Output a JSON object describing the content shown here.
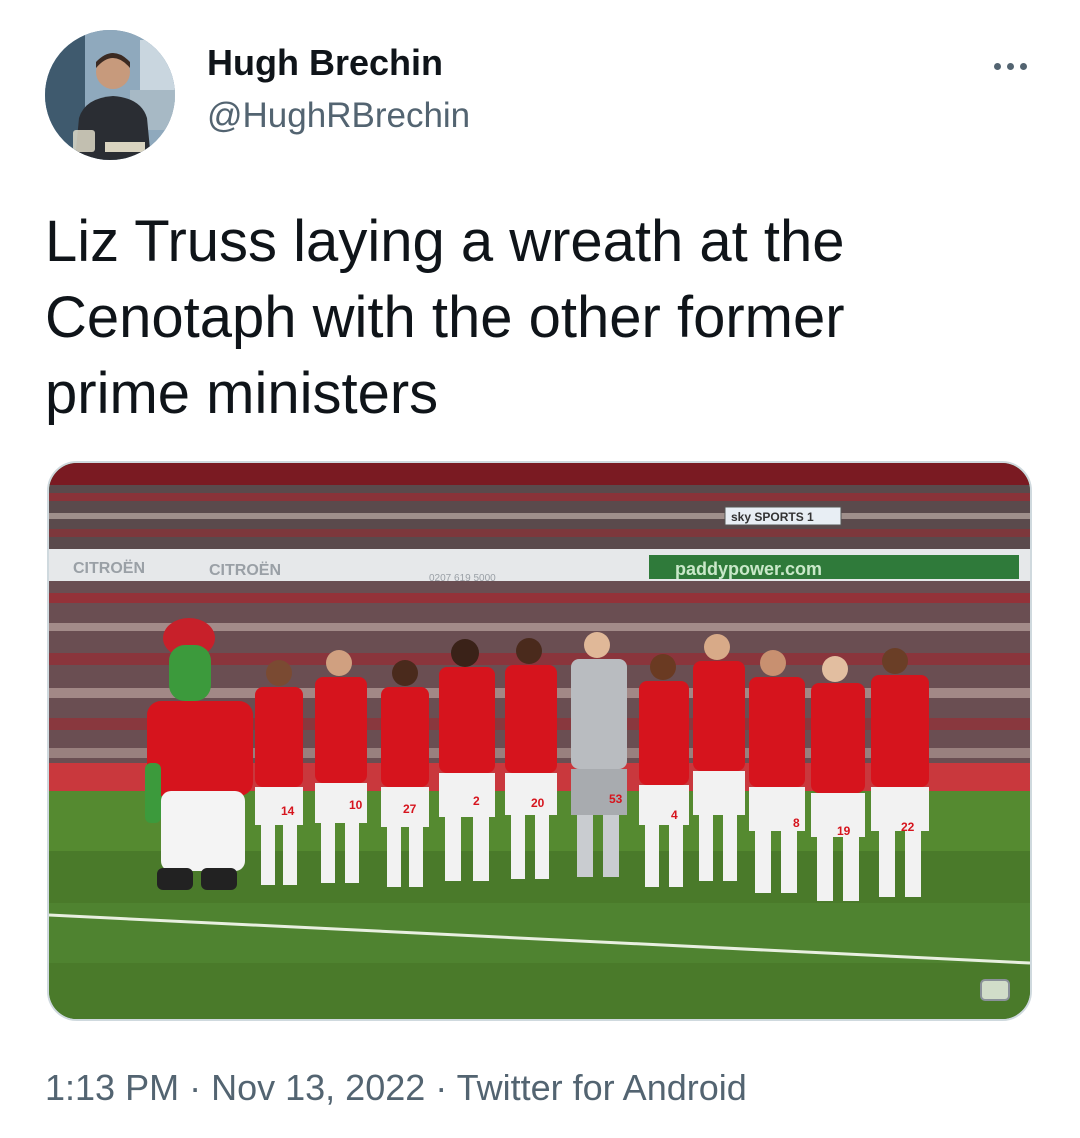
{
  "author": {
    "display_name": "Hugh Brechin",
    "handle": "@HughRBrechin",
    "avatar_icon": "profile-photo"
  },
  "more_menu_icon": "more-horizontal-icon",
  "tweet": {
    "text": "Liz Truss laying a wreath at the\nCenotaph with the other former\nprime ministers"
  },
  "media": {
    "description_icon": "photo",
    "stadium_ads": {
      "left_board": "CITROËN",
      "left_board_2": "CITROËN",
      "phone": "0207 619 5000",
      "right_board": "paddypower.com",
      "broadcaster": "sky SPORTS 1"
    },
    "shirt_numbers": [
      "14",
      "10",
      "27",
      "2",
      "20",
      "53",
      "4",
      "8",
      "19",
      "22"
    ],
    "colors": {
      "shirt_red": "#d6141d",
      "pitch_green": "#4a7a2a",
      "stand_red": "#b0202a"
    }
  },
  "footer": {
    "time": "1:13 PM",
    "separator": "·",
    "date": "Nov 13, 2022",
    "source": "Twitter for Android"
  }
}
